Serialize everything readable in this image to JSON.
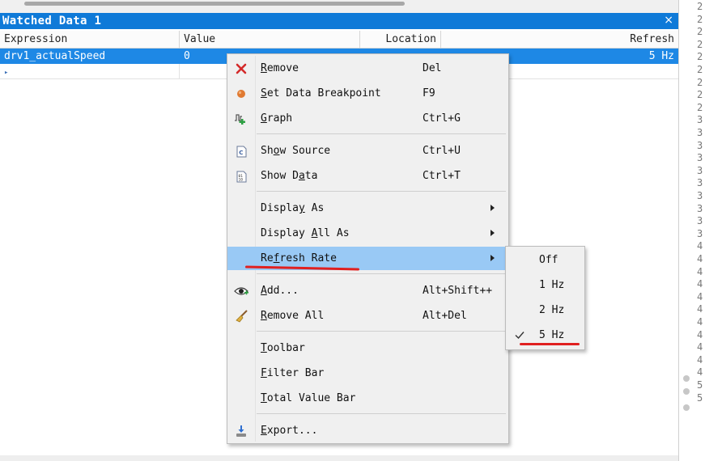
{
  "panel": {
    "title": "Watched Data 1",
    "close_glyph": "×"
  },
  "table": {
    "headers": {
      "expression": "Expression",
      "value": "Value",
      "location": "Location",
      "refresh": "Refresh"
    },
    "rows": [
      {
        "expression": "drv1_actualSpeed",
        "value": "0",
        "location": "",
        "refresh": "5 Hz",
        "selected": true
      }
    ],
    "add_row_marker": "▸"
  },
  "context_menu": {
    "items": [
      {
        "id": "remove",
        "label": "Remove",
        "mnemonic": "R",
        "shortcut": "Del",
        "icon": "red-x-icon"
      },
      {
        "id": "set-data-breakpoint",
        "label": "Set Data Breakpoint",
        "mnemonic": "S",
        "shortcut": "F9",
        "icon": "orange-dot-icon"
      },
      {
        "id": "graph",
        "label": "Graph",
        "mnemonic": "G",
        "shortcut": "Ctrl+G",
        "icon": "graph-icon"
      },
      {
        "id": "show-source",
        "label": "Show Source",
        "mnemonic": "o",
        "shortcut": "Ctrl+U",
        "icon": "c-file-icon"
      },
      {
        "id": "show-data",
        "label": "Show Data",
        "mnemonic": "a",
        "shortcut": "Ctrl+T",
        "icon": "data-file-icon"
      },
      {
        "id": "display-as",
        "label": "Display As",
        "mnemonic": "y",
        "shortcut": "",
        "submenu": true
      },
      {
        "id": "display-all-as",
        "label": "Display All As",
        "mnemonic": "A",
        "shortcut": "",
        "submenu": true
      },
      {
        "id": "refresh-rate",
        "label": "Refresh Rate",
        "mnemonic": "f",
        "shortcut": "",
        "submenu": true,
        "highlighted": true
      },
      {
        "id": "add",
        "label": "Add...",
        "mnemonic": "A",
        "shortcut": "Alt+Shift++",
        "icon": "eye-icon"
      },
      {
        "id": "remove-all",
        "label": "Remove All",
        "mnemonic": "R",
        "shortcut": "Alt+Del",
        "icon": "broom-icon"
      },
      {
        "id": "toolbar",
        "label": "Toolbar",
        "mnemonic": "T",
        "shortcut": ""
      },
      {
        "id": "filter-bar",
        "label": "Filter Bar",
        "mnemonic": "F",
        "shortcut": ""
      },
      {
        "id": "total-value-bar",
        "label": "Total Value Bar",
        "mnemonic": "T",
        "shortcut": ""
      },
      {
        "id": "export",
        "label": "Export...",
        "mnemonic": "E",
        "shortcut": "",
        "icon": "export-icon"
      }
    ]
  },
  "refresh_submenu": {
    "options": [
      {
        "label": "Off",
        "checked": false
      },
      {
        "label": "1 Hz",
        "checked": false
      },
      {
        "label": "2 Hz",
        "checked": false
      },
      {
        "label": "5 Hz",
        "checked": true
      }
    ]
  },
  "editor_gutter": {
    "line_numbers": [
      "2",
      "2",
      "2",
      "2",
      "2",
      "2",
      "2",
      "2",
      "2",
      "3",
      "3",
      "3",
      "3",
      "3",
      "3",
      "3",
      "3",
      "3",
      "3",
      "4",
      "4",
      "4",
      "4",
      "4",
      "4",
      "4",
      "4",
      "4",
      "4",
      "4",
      "5",
      "5"
    ]
  },
  "colors": {
    "title_bar": "#0f7ad8",
    "selection": "#1e88e5",
    "menu_highlight": "#99c9f5",
    "annotation": "#e02020"
  }
}
